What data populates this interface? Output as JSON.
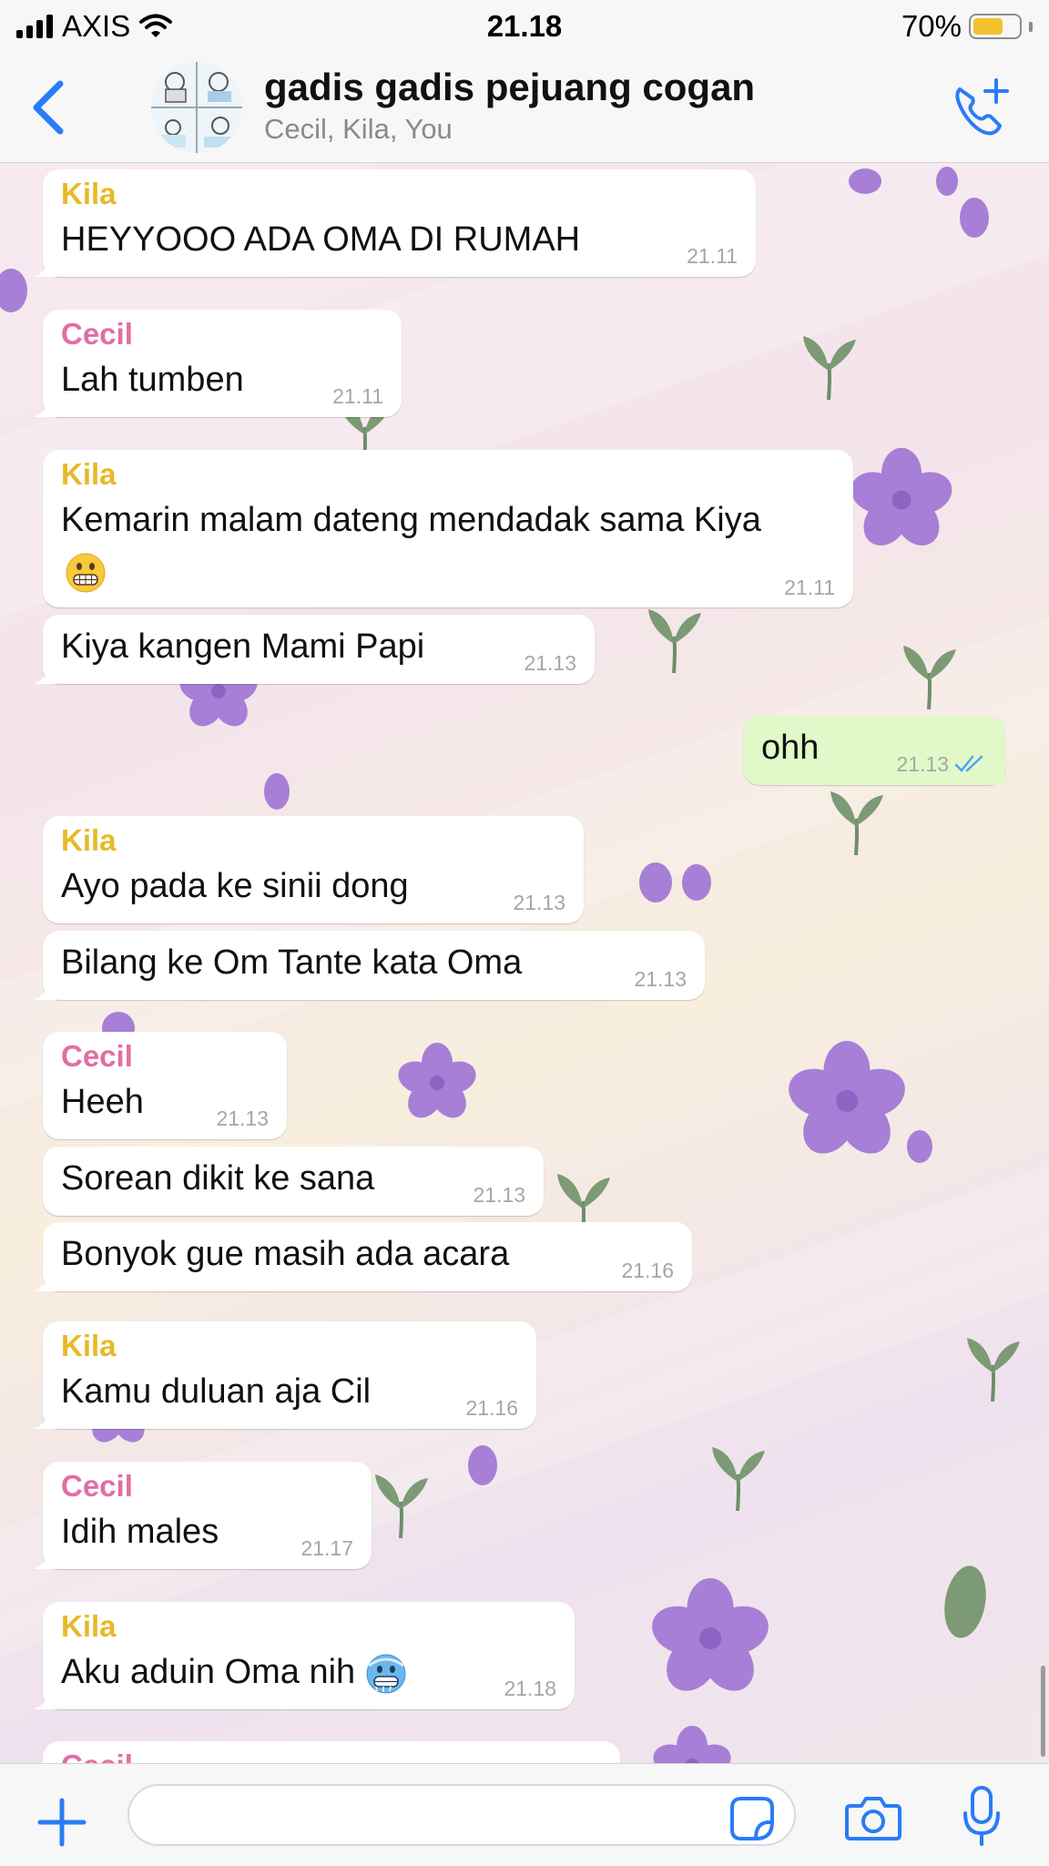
{
  "status_bar": {
    "carrier": "AXIS",
    "time": "21.18",
    "battery": "70%",
    "battery_level": 0.7
  },
  "header": {
    "title": "gadis gadis pejuang cogan",
    "subtitle": "Cecil, Kila, You",
    "icons": [
      "back-chevron-icon",
      "group-avatar",
      "add-call-icon"
    ]
  },
  "colors": {
    "accent": "#2a7cf6",
    "kila": "#e8b928",
    "cecil": "#e06fa3",
    "outgoing": "#e1f9c8",
    "read_ticks": "#4fa3f7"
  },
  "messages": [
    {
      "sender": "Kila",
      "text": "HEYYOOO ADA OMA DI RUMAH",
      "time": "21.11"
    },
    {
      "sender": "Cecil",
      "text": "Lah tumben",
      "time": "21.11"
    },
    {
      "sender": "Kila",
      "text": "Kemarin malam dateng mendadak sama Kiya",
      "emoji": "grimacing-face",
      "time": "21.11"
    },
    {
      "text": "Kiya kangen Mami Papi",
      "time": "21.13"
    },
    {
      "text": "ohh",
      "time": "21.13",
      "outgoing": true,
      "status": "read"
    },
    {
      "sender": "Kila",
      "text": "Ayo pada ke sinii dong",
      "time": "21.13"
    },
    {
      "text": "Bilang ke Om Tante kata Oma",
      "time": "21.13"
    },
    {
      "sender": "Cecil",
      "text": "Heeh",
      "time": "21.13"
    },
    {
      "text": "Sorean dikit ke sana",
      "time": "21.13"
    },
    {
      "text": "Bonyok gue masih ada acara",
      "time": "21.16"
    },
    {
      "sender": "Kila",
      "text": "Kamu duluan aja Cil",
      "time": "21.16"
    },
    {
      "sender": "Cecil",
      "text": "Idih males",
      "time": "21.17"
    },
    {
      "sender": "Kila",
      "text": "Aku aduin Oma nih",
      "emoji": "cold-face",
      "time": "21.18"
    },
    {
      "sender": "Cecil",
      "text": "",
      "time": "",
      "partial": true
    }
  ],
  "composer": {
    "input_value": "",
    "icons": [
      "plus-icon",
      "sticker-icon",
      "camera-icon",
      "mic-icon"
    ]
  }
}
